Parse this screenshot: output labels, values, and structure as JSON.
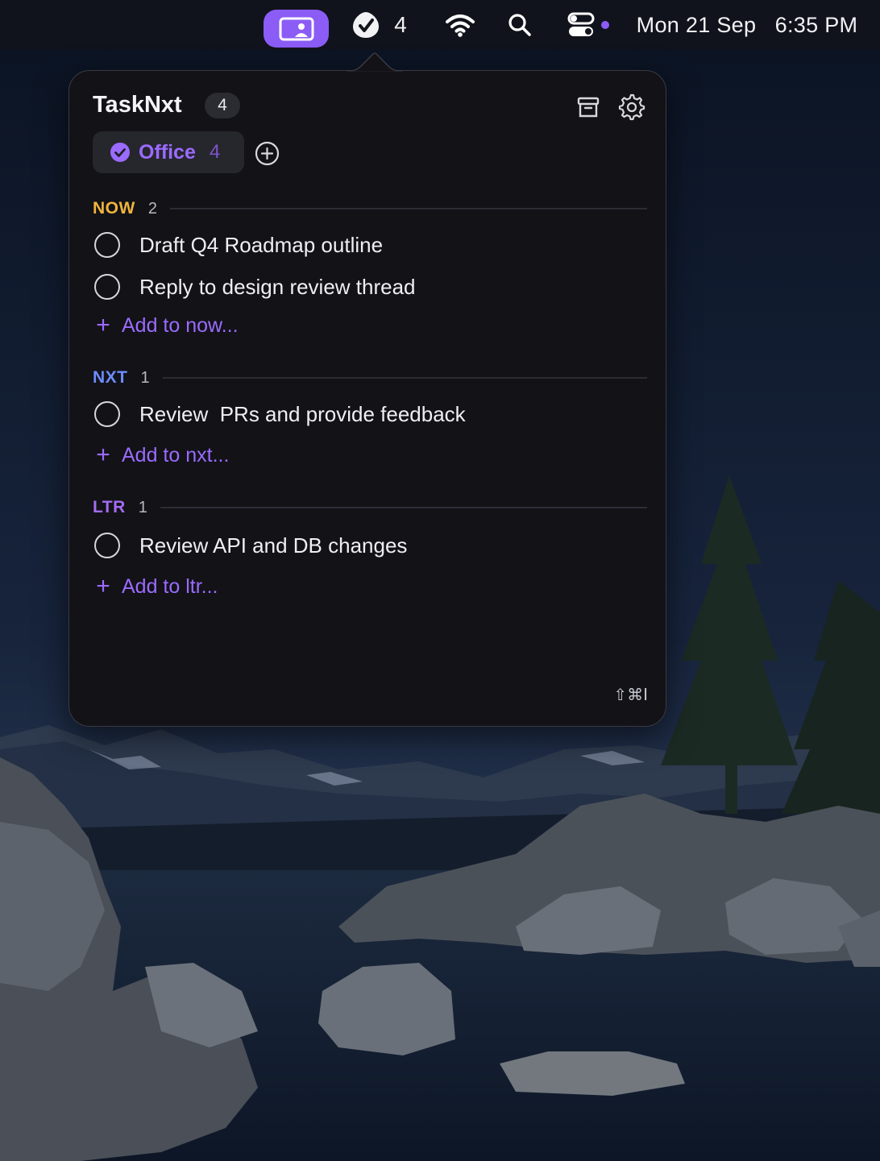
{
  "menubar": {
    "task_count": "4",
    "clock": "Mon 21 Sep   6:35 PM",
    "accent": "#8b5cf6"
  },
  "popover": {
    "title": "TaskNxt",
    "title_count": "4",
    "icons": [
      "archive-icon",
      "gear-icon"
    ],
    "active_list": {
      "name": "Office",
      "count": "4"
    },
    "add_list_icon": "plus-circle-icon",
    "sections": [
      {
        "label": "NOW",
        "count": "2",
        "color": "#f0b43c",
        "tasks": [
          "Draft Q4 Roadmap outline",
          "Reply to design review thread"
        ],
        "add_label": "Add to now..."
      },
      {
        "label": "NXT",
        "count": "1",
        "color": "#6d8cff",
        "tasks": [
          "Review  PRs and provide feedback"
        ],
        "add_label": "Add to nxt..."
      },
      {
        "label": "LTR",
        "count": "1",
        "color": "#a46bf2",
        "tasks": [
          "Review API and DB changes"
        ],
        "add_label": "Add to ltr..."
      }
    ],
    "shortcut": "⇧⌘I"
  }
}
